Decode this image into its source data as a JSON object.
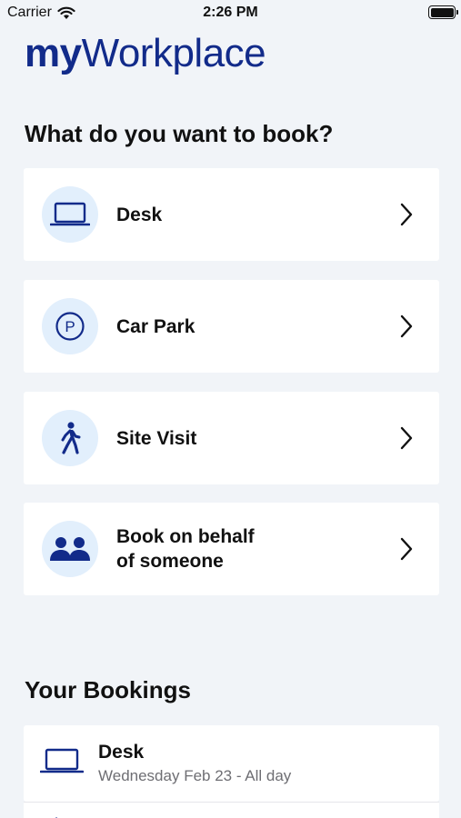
{
  "status_bar": {
    "carrier": "Carrier",
    "time": "2:26 PM"
  },
  "logo": {
    "part1": "my",
    "part2": "Workplace"
  },
  "book_section": {
    "title": "What do you want to book?",
    "options": [
      {
        "label": "Desk",
        "icon": "laptop-icon"
      },
      {
        "label": "Car Park",
        "icon": "parking-icon"
      },
      {
        "label": "Site Visit",
        "icon": "walking-person-icon"
      },
      {
        "label_line1": "Book on behalf",
        "label_line2": "of someone",
        "icon": "people-icon"
      }
    ]
  },
  "bookings_section": {
    "title": "Your Bookings",
    "items": [
      {
        "title": "Desk",
        "subtitle": "Wednesday Feb 23 - All day",
        "icon": "laptop-icon"
      }
    ]
  },
  "colors": {
    "brand": "#122b8a",
    "background": "#f1f4f8",
    "icon_circle": "#e2effc"
  }
}
